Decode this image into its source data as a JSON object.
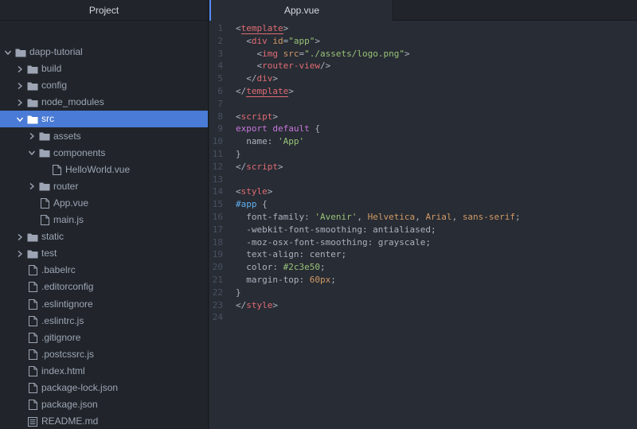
{
  "project_panel": {
    "title": "Project",
    "tree": [
      {
        "label": "dapp-tutorial",
        "type": "folder",
        "depth": 0,
        "expanded": true
      },
      {
        "label": "build",
        "type": "folder",
        "depth": 1,
        "expanded": false
      },
      {
        "label": "config",
        "type": "folder",
        "depth": 1,
        "expanded": false
      },
      {
        "label": "node_modules",
        "type": "folder",
        "depth": 1,
        "expanded": false
      },
      {
        "label": "src",
        "type": "folder",
        "depth": 1,
        "expanded": true,
        "selected": true
      },
      {
        "label": "assets",
        "type": "folder",
        "depth": 2,
        "expanded": false
      },
      {
        "label": "components",
        "type": "folder",
        "depth": 2,
        "expanded": true
      },
      {
        "label": "HelloWorld.vue",
        "type": "file",
        "depth": 3
      },
      {
        "label": "router",
        "type": "folder",
        "depth": 2,
        "expanded": false
      },
      {
        "label": "App.vue",
        "type": "file",
        "depth": 2
      },
      {
        "label": "main.js",
        "type": "file",
        "depth": 2
      },
      {
        "label": "static",
        "type": "folder",
        "depth": 1,
        "expanded": false
      },
      {
        "label": "test",
        "type": "folder",
        "depth": 1,
        "expanded": false
      },
      {
        "label": ".babelrc",
        "type": "file",
        "depth": 1
      },
      {
        "label": ".editorconfig",
        "type": "file",
        "depth": 1
      },
      {
        "label": ".eslintignore",
        "type": "file",
        "depth": 1
      },
      {
        "label": ".eslintrc.js",
        "type": "file",
        "depth": 1
      },
      {
        "label": ".gitignore",
        "type": "file",
        "depth": 1
      },
      {
        "label": ".postcssrc.js",
        "type": "file",
        "depth": 1
      },
      {
        "label": "index.html",
        "type": "file",
        "depth": 1
      },
      {
        "label": "package-lock.json",
        "type": "file",
        "depth": 1
      },
      {
        "label": "package.json",
        "type": "file",
        "depth": 1
      },
      {
        "label": "README.md",
        "type": "file-text",
        "depth": 1
      }
    ]
  },
  "editor": {
    "active_tab": "App.vue",
    "lines": [
      [
        [
          "<",
          "t-punct"
        ],
        [
          "template",
          "t-tag u-template"
        ],
        [
          ">",
          "t-punct"
        ]
      ],
      [
        [
          "  <",
          "t-punct"
        ],
        [
          "div",
          "t-tag"
        ],
        [
          " ",
          ""
        ],
        [
          "id",
          "t-attr"
        ],
        [
          "=",
          ""
        ],
        [
          "\"app\"",
          "t-str"
        ],
        [
          ">",
          "t-punct"
        ]
      ],
      [
        [
          "    <",
          "t-punct"
        ],
        [
          "img",
          "t-tag"
        ],
        [
          " ",
          ""
        ],
        [
          "src",
          "t-attr"
        ],
        [
          "=",
          ""
        ],
        [
          "\"./assets/logo.png\"",
          "t-str"
        ],
        [
          ">",
          "t-punct"
        ]
      ],
      [
        [
          "    <",
          "t-punct"
        ],
        [
          "router-view",
          "t-tag"
        ],
        [
          "/>",
          "t-punct"
        ]
      ],
      [
        [
          "  </",
          "t-punct"
        ],
        [
          "div",
          "t-tag"
        ],
        [
          ">",
          "t-punct"
        ]
      ],
      [
        [
          "</",
          "t-punct"
        ],
        [
          "template",
          "t-tag u-template"
        ],
        [
          ">",
          "t-punct"
        ]
      ],
      [],
      [
        [
          "<",
          "t-punct"
        ],
        [
          "script",
          "t-tag"
        ],
        [
          ">",
          "t-punct"
        ]
      ],
      [
        [
          "export",
          "t-kw"
        ],
        [
          " ",
          ""
        ],
        [
          "default",
          "t-kw"
        ],
        [
          " {",
          ""
        ]
      ],
      [
        [
          "  name: ",
          ""
        ],
        [
          "'App'",
          "t-str"
        ]
      ],
      [
        [
          "}",
          ""
        ]
      ],
      [
        [
          "</",
          "t-punct"
        ],
        [
          "script",
          "t-tag"
        ],
        [
          ">",
          "t-punct"
        ]
      ],
      [],
      [
        [
          "<",
          "t-punct"
        ],
        [
          "style",
          "t-tag"
        ],
        [
          ">",
          "t-punct"
        ]
      ],
      [
        [
          "#app",
          "t-sel"
        ],
        [
          " {",
          ""
        ]
      ],
      [
        [
          "  font-family: ",
          ""
        ],
        [
          "'Avenir'",
          "t-str"
        ],
        [
          ", ",
          ""
        ],
        [
          "Helvetica",
          "t-num"
        ],
        [
          ", ",
          ""
        ],
        [
          "Arial",
          "t-num"
        ],
        [
          ", ",
          ""
        ],
        [
          "sans-serif",
          "t-num"
        ],
        [
          ";",
          ""
        ]
      ],
      [
        [
          "  -webkit-font-smoothing: antialiased;",
          ""
        ]
      ],
      [
        [
          "  -moz-osx-font-smoothing: grayscale;",
          ""
        ]
      ],
      [
        [
          "  text-align: center;",
          ""
        ]
      ],
      [
        [
          "  color: ",
          ""
        ],
        [
          "#2c3e50",
          "t-str"
        ],
        [
          ";",
          ""
        ]
      ],
      [
        [
          "  margin-top: ",
          ""
        ],
        [
          "60px",
          "t-num"
        ],
        [
          ";",
          ""
        ]
      ],
      [
        [
          "}",
          ""
        ]
      ],
      [
        [
          "</",
          "t-punct"
        ],
        [
          "style",
          "t-tag"
        ],
        [
          ">",
          "t-punct"
        ]
      ],
      []
    ]
  }
}
